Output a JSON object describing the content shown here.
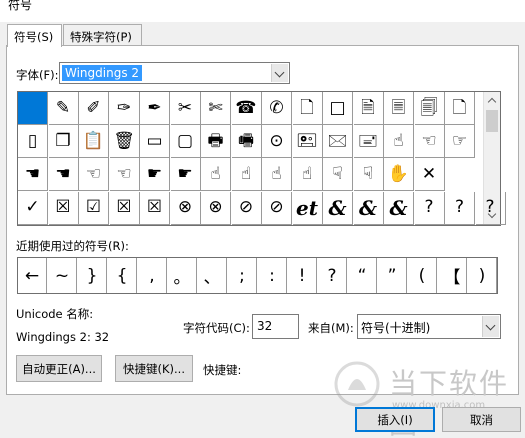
{
  "window": {
    "title": "符号"
  },
  "tabs": [
    {
      "label": "符号(S)",
      "active": true
    },
    {
      "label": "特殊字符(P)",
      "active": false
    }
  ],
  "font": {
    "label": "字体(F):",
    "value": "Wingdings 2"
  },
  "symbol_grid": {
    "rows": [
      [
        {
          "char": "",
          "selected": true
        },
        {
          "char": "✎"
        },
        {
          "char": "✐"
        },
        {
          "char": "✑"
        },
        {
          "char": "✒"
        },
        {
          "char": "✂"
        },
        {
          "char": "✄"
        },
        {
          "char": "☎"
        },
        {
          "char": "✆"
        },
        {
          "char": "🗋"
        },
        {
          "char": "□"
        },
        {
          "char": "🗎"
        },
        {
          "char": "🗏"
        },
        {
          "char": "🗐"
        },
        {
          "char": "🗋"
        }
      ],
      [
        {
          "char": "▯"
        },
        {
          "char": "❐"
        },
        {
          "char": "📋"
        },
        {
          "char": "🗑"
        },
        {
          "char": "▭"
        },
        {
          "char": "▢"
        },
        {
          "char": "🖶"
        },
        {
          "char": "🖷"
        },
        {
          "char": "⊙"
        },
        {
          "char": "🖭"
        },
        {
          "char": "🖂"
        },
        {
          "char": "🖃"
        },
        {
          "char": "☝"
        },
        {
          "char": "☜"
        },
        {
          "char": "☞"
        }
      ],
      [
        {
          "char": "☚"
        },
        {
          "char": "☚"
        },
        {
          "char": "☜"
        },
        {
          "char": "☜"
        },
        {
          "char": "☛"
        },
        {
          "char": "☛"
        },
        {
          "char": "☝"
        },
        {
          "char": "☝"
        },
        {
          "char": "☝"
        },
        {
          "char": "☝"
        },
        {
          "char": "☟"
        },
        {
          "char": "☟"
        },
        {
          "char": "✋"
        },
        {
          "char": "✕"
        }
      ],
      [
        {
          "char": "✓"
        },
        {
          "char": "☒"
        },
        {
          "char": "☑"
        },
        {
          "char": "☒"
        },
        {
          "char": "☒"
        },
        {
          "char": "⊗"
        },
        {
          "char": "⊗"
        },
        {
          "char": "⊘"
        },
        {
          "char": "⊘"
        },
        {
          "char": "et"
        },
        {
          "char": "&"
        },
        {
          "char": "&"
        },
        {
          "char": "&"
        },
        {
          "char": "?"
        },
        {
          "char": "?"
        },
        {
          "char": "?"
        }
      ]
    ]
  },
  "recent": {
    "label": "近期使用过的符号(R):",
    "chars": [
      "←",
      "~",
      "}",
      "{",
      ",",
      "。",
      "、",
      ";",
      ":",
      "!",
      "?",
      "“",
      "”",
      "(",
      "【",
      ")"
    ]
  },
  "unicode": {
    "label": "Unicode 名称:",
    "value": "Wingdings 2: 32"
  },
  "char_code": {
    "label": "字符代码(C):",
    "value": "32"
  },
  "from": {
    "label": "来自(M):",
    "value": "符号(十进制)"
  },
  "buttons": {
    "autocorrect": "自动更正(A)...",
    "shortcut_key": "快捷键(K)...",
    "insert": "插入(I)",
    "cancel": "取消"
  },
  "shortcut_label": "快捷键:",
  "watermark": {
    "text": "当下软件园",
    "url": "www.downxia.com"
  }
}
